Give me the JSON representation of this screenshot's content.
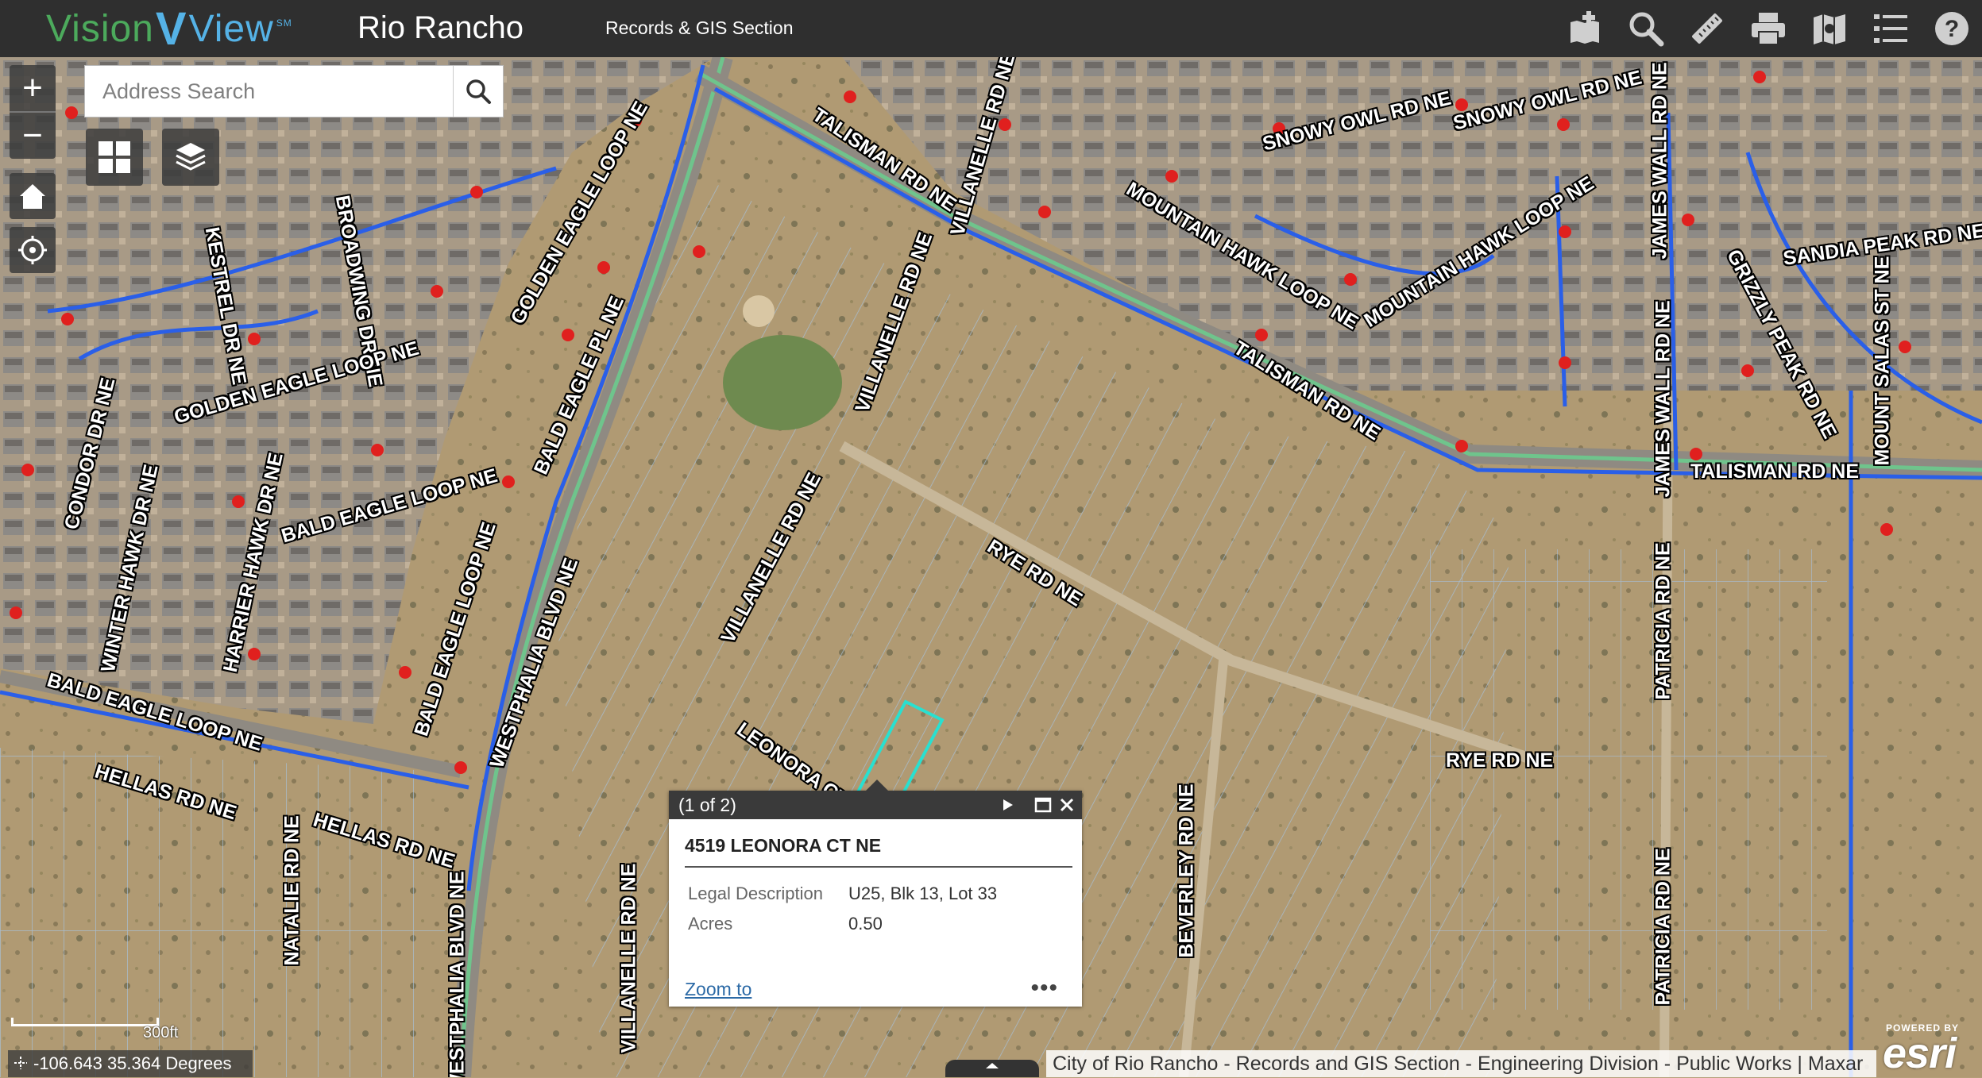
{
  "header": {
    "logo_word1": "Vision",
    "logo_v": "V",
    "logo_word2": "View",
    "logo_sm": "SM",
    "title": "Rio Rancho",
    "subtitle": "Records & GIS Section",
    "tools": [
      {
        "name": "add-data-icon"
      },
      {
        "name": "search-tool-icon"
      },
      {
        "name": "measure-icon"
      },
      {
        "name": "print-icon"
      },
      {
        "name": "basemap-gallery-icon"
      },
      {
        "name": "layer-list-icon"
      },
      {
        "name": "help-icon"
      }
    ]
  },
  "search": {
    "placeholder": "Address Search"
  },
  "zoom": {
    "in": "+",
    "out": "−"
  },
  "roads": [
    {
      "label": "SNOWY OWL RD NE"
    },
    {
      "label": "SNOWY OWL RD NE"
    },
    {
      "label": "TALISMAN RD NE"
    },
    {
      "label": "VILLANELLE RD NE"
    },
    {
      "label": "MOUNTAIN HAWK LOOP NE"
    },
    {
      "label": "MOUNTAIN HAWK LOOP NE"
    },
    {
      "label": "JAMES WALL RD NE"
    },
    {
      "label": "SANDIA PEAK RD NE"
    },
    {
      "label": "GRIZZLY PEAK RD NE"
    },
    {
      "label": "GOLDEN EAGLE LOOP NE"
    },
    {
      "label": "BROADWING DR NE"
    },
    {
      "label": "KESTREL DR NE"
    },
    {
      "label": "GOLDEN EAGLE LOOP NE"
    },
    {
      "label": "BALD EAGLE PL NE"
    },
    {
      "label": "CONDOR DR NE"
    },
    {
      "label": "BALD EAGLE LOOP NE"
    },
    {
      "label": "WINTER HAWK DR NE"
    },
    {
      "label": "HARRIER HAWK DR NE"
    },
    {
      "label": "BALD EAGLE LOOP NE"
    },
    {
      "label": "WESTPHALIA BLVD NE"
    },
    {
      "label": "BALD EAGLE LOOP NE"
    },
    {
      "label": "HELLAS RD NE"
    },
    {
      "label": "HELLAS RD NE"
    },
    {
      "label": "VILLANELLE RD NE"
    },
    {
      "label": "VILLANELLE RD NE"
    },
    {
      "label": "TALISMAN RD NE"
    },
    {
      "label": "TALISMAN RD NE"
    },
    {
      "label": "RYE RD NE"
    },
    {
      "label": "LEONORA CT NE"
    },
    {
      "label": "RYE RD NE"
    },
    {
      "label": "PATRICIA RD NE"
    },
    {
      "label": "PATRICIA RD NE"
    },
    {
      "label": "BEVERLEY RD NE"
    },
    {
      "label": "MOUNT SALAS ST NE"
    },
    {
      "label": "NATALIE RD NE"
    },
    {
      "label": "WESTPHALIA BLVD NE"
    },
    {
      "label": "VILLANELLE RD NE"
    },
    {
      "label": "JAMES WALL RD NE"
    }
  ],
  "popup": {
    "counter": "(1 of 2)",
    "title": "4519 LEONORA CT NE",
    "fields": [
      {
        "key": "Legal Description",
        "value": "U25, Blk 13, Lot 33"
      },
      {
        "key": "Acres",
        "value": "0.50"
      }
    ],
    "zoom_to": "Zoom to",
    "more": "•••"
  },
  "scalebar": {
    "label": "300ft"
  },
  "coordinates": "-106.643 35.364 Degrees",
  "attribution": "City of Rio Rancho - Records and GIS Section - Engineering Division - Public Works | Maxar",
  "esri": {
    "powered_by": "POWERED BY",
    "name": "esri"
  },
  "colors": {
    "header_bg": "#2f2f2f",
    "water_line": "#2a5fe8",
    "sewer_line": "#6fc48c",
    "parcel_line": "#a7c0d8",
    "selected_parcel": "#29e0d0",
    "hydrant": "#e0201e"
  }
}
